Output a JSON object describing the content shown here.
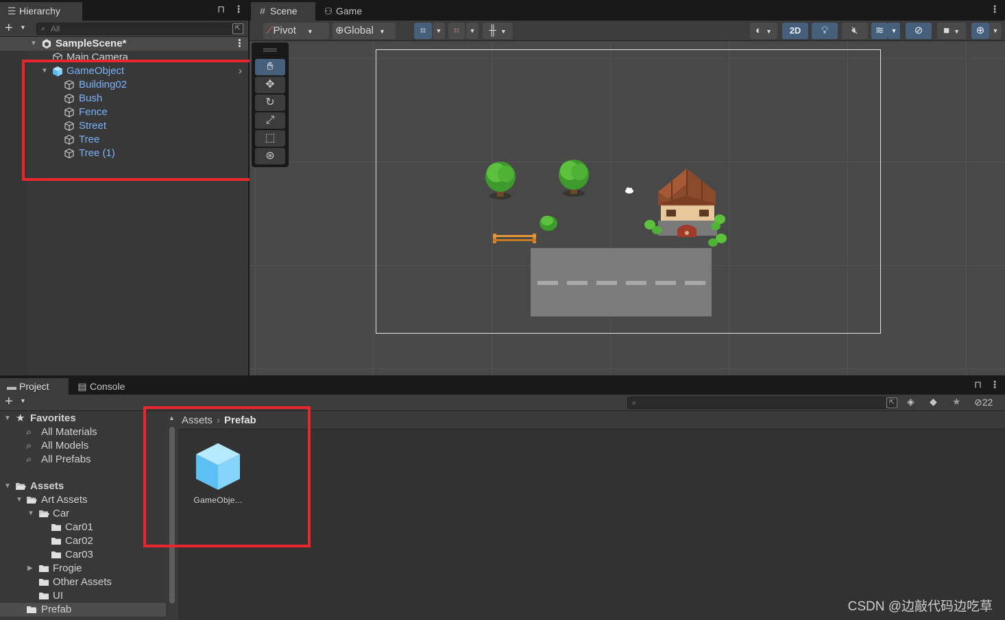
{
  "hierarchy": {
    "tab_label": "Hierarchy",
    "search_placeholder": "All",
    "scene_name": "SampleScene*",
    "items": [
      {
        "label": "Main Camera"
      },
      {
        "label": "GameObject"
      },
      {
        "label": "Building02"
      },
      {
        "label": "Bush"
      },
      {
        "label": "Fence"
      },
      {
        "label": "Street"
      },
      {
        "label": "Tree"
      },
      {
        "label": "Tree (1)"
      }
    ]
  },
  "scene": {
    "tabs": [
      {
        "label": "Scene"
      },
      {
        "label": "Game"
      }
    ],
    "toolbar": {
      "pivot_label": "Pivot",
      "global_label": "Global",
      "mode_2d_label": "2D"
    },
    "tools": [
      "hand-tool",
      "move-tool",
      "rotate-tool",
      "scale-tool",
      "rect-tool",
      "transform-tool"
    ]
  },
  "project": {
    "tabs": [
      {
        "label": "Project"
      },
      {
        "label": "Console"
      }
    ],
    "hidden_count": "22",
    "tree": {
      "favorites_label": "Favorites",
      "favorites": [
        {
          "label": "All Materials"
        },
        {
          "label": "All Models"
        },
        {
          "label": "All Prefabs"
        }
      ],
      "assets_label": "Assets",
      "items": [
        {
          "label": "Art Assets"
        },
        {
          "label": "Car"
        },
        {
          "label": "Car01"
        },
        {
          "label": "Car02"
        },
        {
          "label": "Car03"
        },
        {
          "label": "Frogie"
        },
        {
          "label": "Other Assets"
        },
        {
          "label": "UI"
        },
        {
          "label": "Prefab"
        }
      ]
    },
    "breadcrumb": {
      "root": "Assets",
      "current": "Prefab"
    },
    "assets": [
      {
        "label": "GameObje..."
      }
    ]
  },
  "watermark": "CSDN @边敲代码边吃草",
  "colors": {
    "accent_blue": "#7cb3f8",
    "highlight_red": "#e8262b",
    "active_tool": "#46607c"
  }
}
